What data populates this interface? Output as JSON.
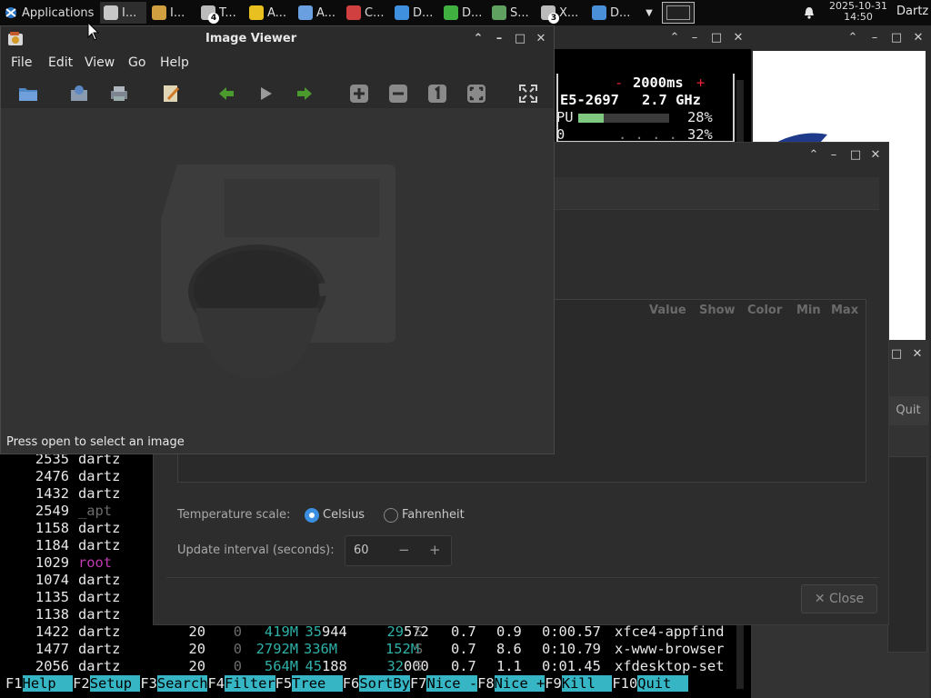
{
  "panel": {
    "applications_label": "Applications",
    "tasks": [
      {
        "label": "I...",
        "icon": "imageviewer-icon",
        "color": "#c8c8c8"
      },
      {
        "label": "I...",
        "icon": "image-icon",
        "color": "#d0a040"
      },
      {
        "label": "T...",
        "icon": "terminal-icon",
        "color": "#bbbbbb",
        "badge": "4"
      },
      {
        "label": "A...",
        "icon": "star-icon",
        "color": "#e8c020"
      },
      {
        "label": "A...",
        "icon": "magnifier-icon",
        "color": "#6aa0e0"
      },
      {
        "label": "C...",
        "icon": "colors-icon",
        "color": "#d04040"
      },
      {
        "label": "D...",
        "icon": "document-icon",
        "color": "#4090e0"
      },
      {
        "label": "D...",
        "icon": "mosaic-icon",
        "color": "#40b040"
      },
      {
        "label": "S...",
        "icon": "disk-icon",
        "color": "#60a060"
      },
      {
        "label": "X...",
        "icon": "terminal-icon",
        "color": "#bbbbbb",
        "badge": "3"
      },
      {
        "label": "D...",
        "icon": "display-icon",
        "color": "#4a90d9"
      }
    ],
    "clock_date": "2025-10-31",
    "clock_time": "14:50",
    "user": "Dartz"
  },
  "image_viewer": {
    "title": "Image Viewer",
    "menu": [
      "File",
      "Edit",
      "View",
      "Go",
      "Help"
    ],
    "status": "Press open to select an image"
  },
  "htop": {
    "interval": "2000ms",
    "minus": "-",
    "plus": "+",
    "cpu_model": "E5-2697",
    "cpu_freq": "2.7 GHz",
    "cpu_label": "PU",
    "cpu_pct": "28%",
    "cpu2_label": "0",
    "cpu2_pct": "32%",
    "cpu_usage_fraction": 0.28,
    "processes": [
      {
        "pid": "2535",
        "user": "dartz",
        "user_color": "#e8e8e8"
      },
      {
        "pid": "2476",
        "user": "dartz",
        "user_color": "#e8e8e8"
      },
      {
        "pid": "1432",
        "user": "dartz",
        "user_color": "#e8e8e8"
      },
      {
        "pid": "2549",
        "user": "_apt",
        "user_color": "#6c6c6c"
      },
      {
        "pid": "1158",
        "user": "dartz",
        "user_color": "#e8e8e8"
      },
      {
        "pid": "1184",
        "user": "dartz",
        "user_color": "#e8e8e8"
      },
      {
        "pid": "1029",
        "user": "root",
        "user_color": "#c03ab0"
      },
      {
        "pid": "1074",
        "user": "dartz",
        "user_color": "#e8e8e8"
      },
      {
        "pid": "1135",
        "user": "dartz",
        "user_color": "#e8e8e8"
      },
      {
        "pid": "1138",
        "user": "dartz",
        "user_color": "#e8e8e8"
      }
    ],
    "full_rows": [
      {
        "pid": "1422",
        "user": "dartz",
        "pri": "20",
        "ni": "0",
        "virt": "419M",
        "res_a": "35",
        "res_b": "944",
        "shr_a": "29",
        "shr_b": "572",
        "s": "S",
        "cpu": "0.7",
        "mem": "0.9",
        "time": "0:00.57",
        "cmd": "xfce4-appfind"
      },
      {
        "pid": "1477",
        "user": "dartz",
        "pri": "20",
        "ni": "0",
        "virt": "2792M",
        "res_a": "336M",
        "res_b": "",
        "shr_a": "152M",
        "shr_b": "",
        "s": "S",
        "cpu": "0.7",
        "mem": "8.6",
        "time": "0:10.79",
        "cmd": "x-www-browser"
      },
      {
        "pid": "2056",
        "user": "dartz",
        "pri": "20",
        "ni": "0",
        "virt": "564M",
        "res_a": "45",
        "res_b": "188",
        "shr_a": "32",
        "shr_b": "000",
        "s": "S",
        "cpu": "0.7",
        "mem": "1.1",
        "time": "0:01.45",
        "cmd": "xfdesktop-set"
      }
    ],
    "fkeys": [
      {
        "key": "F1",
        "label": "Help  "
      },
      {
        "key": "F2",
        "label": "Setup "
      },
      {
        "key": "F3",
        "label": "Search"
      },
      {
        "key": "F4",
        "label": "Filter"
      },
      {
        "key": "F5",
        "label": "Tree  "
      },
      {
        "key": "F6",
        "label": "SortBy"
      },
      {
        "key": "F7",
        "label": "Nice -"
      },
      {
        "key": "F8",
        "label": "Nice +"
      },
      {
        "key": "F9",
        "label": "Kill  "
      },
      {
        "key": "F10",
        "label": "Quit  "
      }
    ]
  },
  "sensors_dialog": {
    "columns": [
      "Value",
      "Show",
      "Color",
      "Min",
      "Max"
    ],
    "temp_scale_label": "Temperature scale:",
    "celsius": "Celsius",
    "fahrenheit": "Fahrenheit",
    "selected_scale": "Celsius",
    "interval_label": "Update interval (seconds):",
    "interval_value": "60",
    "decrement": "−",
    "increment": "+",
    "close_label": "✕ Close"
  },
  "back_window": {
    "quit_label": "Quit"
  }
}
